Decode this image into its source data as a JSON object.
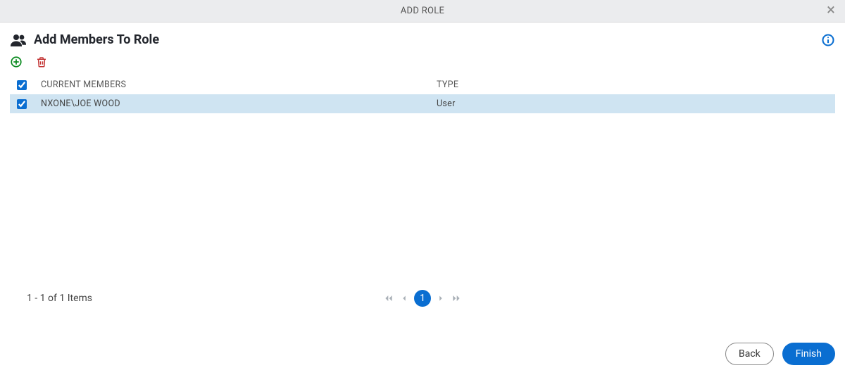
{
  "dialog": {
    "header_title": "ADD ROLE",
    "section_title": "Add Members To Role"
  },
  "table": {
    "headers": {
      "members": "CURRENT MEMBERS",
      "type": "TYPE"
    },
    "rows": [
      {
        "member": "NXONE\\JOE WOOD",
        "type": "User",
        "selected": true
      }
    ]
  },
  "pagination": {
    "items_label": "1 - 1 of 1 Items",
    "current_page": "1"
  },
  "footer": {
    "back_label": "Back",
    "finish_label": "Finish"
  }
}
